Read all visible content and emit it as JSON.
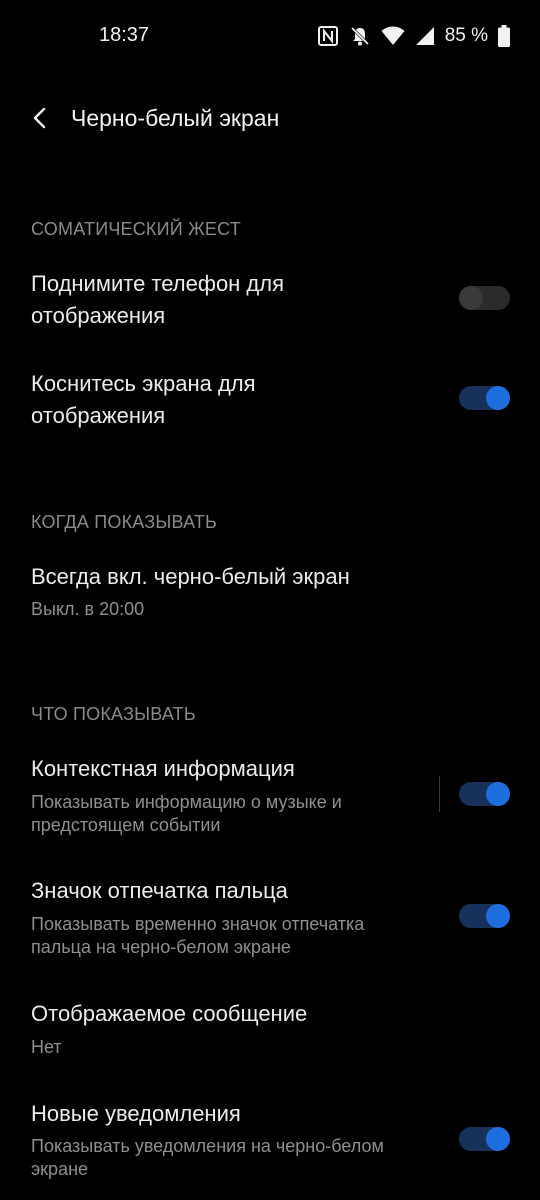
{
  "status_bar": {
    "time": "18:37",
    "battery": "85 %",
    "icons": [
      "nfc-icon",
      "mute-bell-icon",
      "wifi-icon",
      "signal-icon",
      "battery-icon"
    ]
  },
  "header": {
    "title": "Черно-белый экран",
    "back_icon": "chevron-left-icon"
  },
  "sections": {
    "gesture": {
      "title": "СОМАТИЧЕСКИЙ ЖЕСТ",
      "raise": {
        "title_line1": "Поднимите телефон для",
        "title_line2": "отображения",
        "enabled": false
      },
      "tap": {
        "title_line1": "Коснитесь экрана для",
        "title_line2": "отображения",
        "enabled": true
      }
    },
    "when": {
      "title": "КОГДА ПОКАЗЫВАТЬ",
      "always_on": {
        "title": "Всегда вкл. черно-белый экран",
        "subtitle": "Выкл. в 20:00"
      }
    },
    "what": {
      "title": "ЧТО ПОКАЗЫВАТЬ",
      "context": {
        "title": "Контекстная информация",
        "sub_line1": "Показывать информацию о музыке и",
        "sub_line2": "предстоящем событии",
        "enabled": true
      },
      "fingerprint": {
        "title": "Значок отпечатка пальца",
        "sub_line1": "Показывать временно значок отпечатка",
        "sub_line2": "пальца на черно-белом экране",
        "enabled": true
      },
      "message": {
        "title": "Отображаемое сообщение",
        "subtitle": "Нет"
      },
      "notifications": {
        "title": "Новые уведомления",
        "sub_line1": "Показывать уведомления на черно-белом",
        "sub_line2": "экране",
        "enabled": true
      }
    }
  },
  "colors": {
    "accent": "#1f6ee0",
    "toggle_on_track": "#17325a",
    "background": "#000000"
  }
}
